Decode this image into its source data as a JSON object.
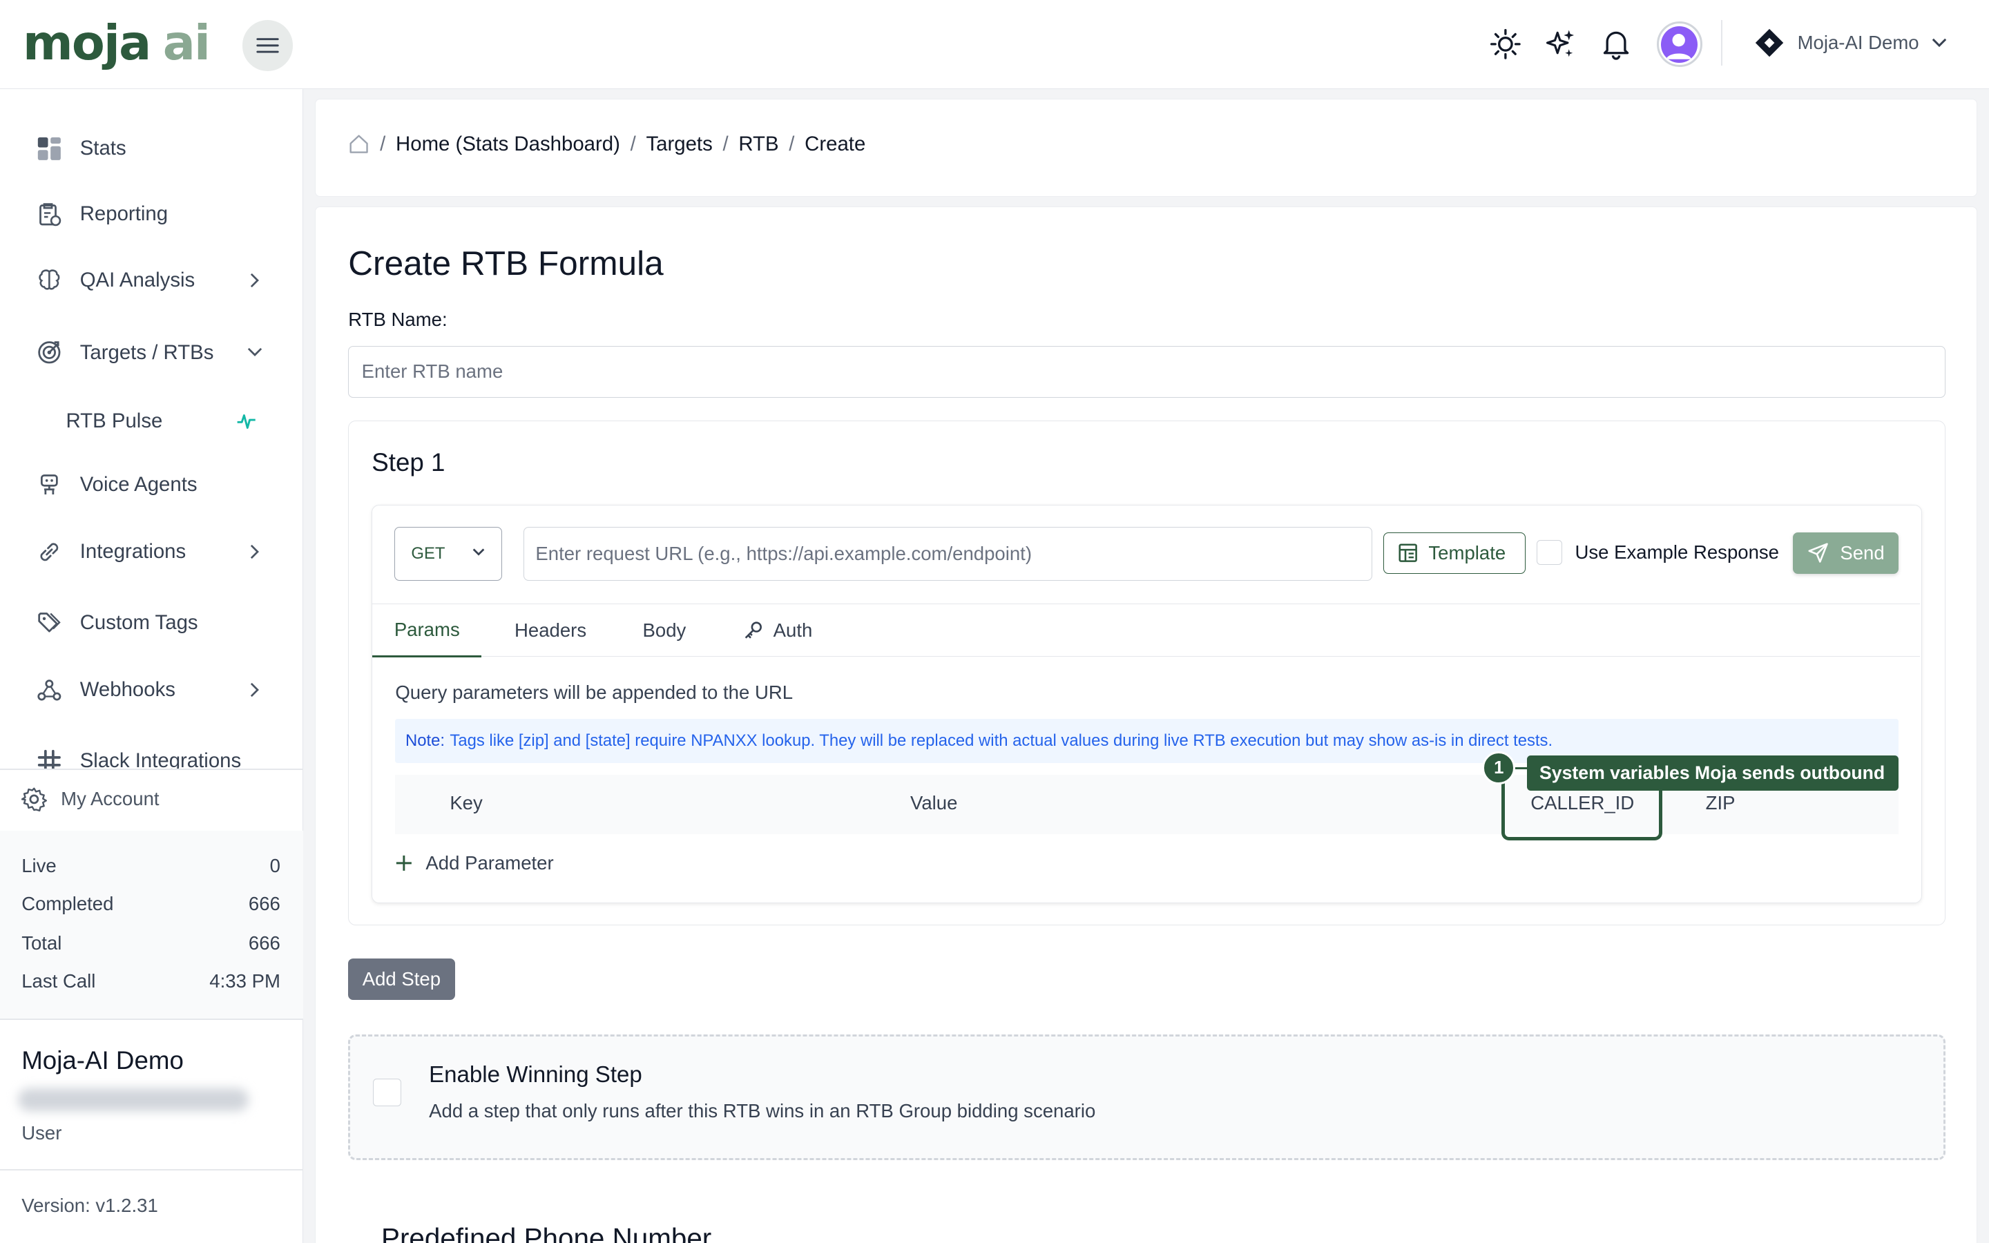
{
  "brand": {
    "logo_main": "moja",
    "logo_accent": "ai",
    "accent_color": "#2d5a3d"
  },
  "header": {
    "icons": [
      "sun-icon",
      "sparkles-icon",
      "bell-icon"
    ],
    "account_name": "Moja-AI Demo"
  },
  "sidebar": {
    "items": [
      {
        "label": "Stats",
        "icon": "grid-icon"
      },
      {
        "label": "Reporting",
        "icon": "report-icon"
      },
      {
        "label": "QAI Analysis",
        "icon": "brain-icon",
        "expandable": true
      },
      {
        "label": "Targets / RTBs",
        "icon": "target-icon",
        "expanded": true
      },
      {
        "label": "RTB Pulse",
        "icon": "pulse-icon",
        "sub": true
      },
      {
        "label": "Voice Agents",
        "icon": "robot-icon"
      },
      {
        "label": "Integrations",
        "icon": "link-icon",
        "expandable": true
      },
      {
        "label": "Custom Tags",
        "icon": "tags-icon"
      },
      {
        "label": "Webhooks",
        "icon": "webhook-icon",
        "expandable": true
      },
      {
        "label": "Slack Integrations",
        "icon": "slack-icon"
      }
    ],
    "my_account": "My Account",
    "stats": [
      {
        "label": "Live",
        "value": "0"
      },
      {
        "label": "Completed",
        "value": "666"
      },
      {
        "label": "Total",
        "value": "666"
      },
      {
        "label": "Last Call",
        "value": "4:33 PM"
      }
    ],
    "org_name": "Moja-AI Demo",
    "role": "User",
    "version": "Version: v1.2.31"
  },
  "breadcrumb": {
    "items": [
      "Home (Stats Dashboard)",
      "Targets",
      "RTB",
      "Create"
    ],
    "separator": "/"
  },
  "form": {
    "title": "Create RTB Formula",
    "rtb_name_label": "RTB Name:",
    "rtb_name_placeholder": "Enter RTB name",
    "step_title": "Step 1",
    "method": "GET",
    "url_placeholder": "Enter request URL (e.g., https://api.example.com/endpoint)",
    "template_label": "Template",
    "example_response_label": "Use Example Response",
    "send_label": "Send",
    "tabs": [
      "Params",
      "Headers",
      "Body",
      "Auth"
    ],
    "params_desc": "Query parameters will be appended to the URL",
    "note_label": "Note:",
    "note_text": "Tags like [zip] and [state] require NPANXX lookup. They will be replaced with actual values during live RTB execution but may show as-is in direct tests.",
    "columns": [
      "Key",
      "Value",
      "CALLER_ID",
      "ZIP"
    ],
    "callout_number": "1",
    "callout_text": "System variables Moja sends outbound",
    "add_param_label": "Add Parameter",
    "add_step_label": "Add Step",
    "winning_title": "Enable Winning Step",
    "winning_desc": "Add a step that only runs after this RTB wins in an RTB Group bidding scenario",
    "predefined_heading": "Predefined Phone Number"
  }
}
